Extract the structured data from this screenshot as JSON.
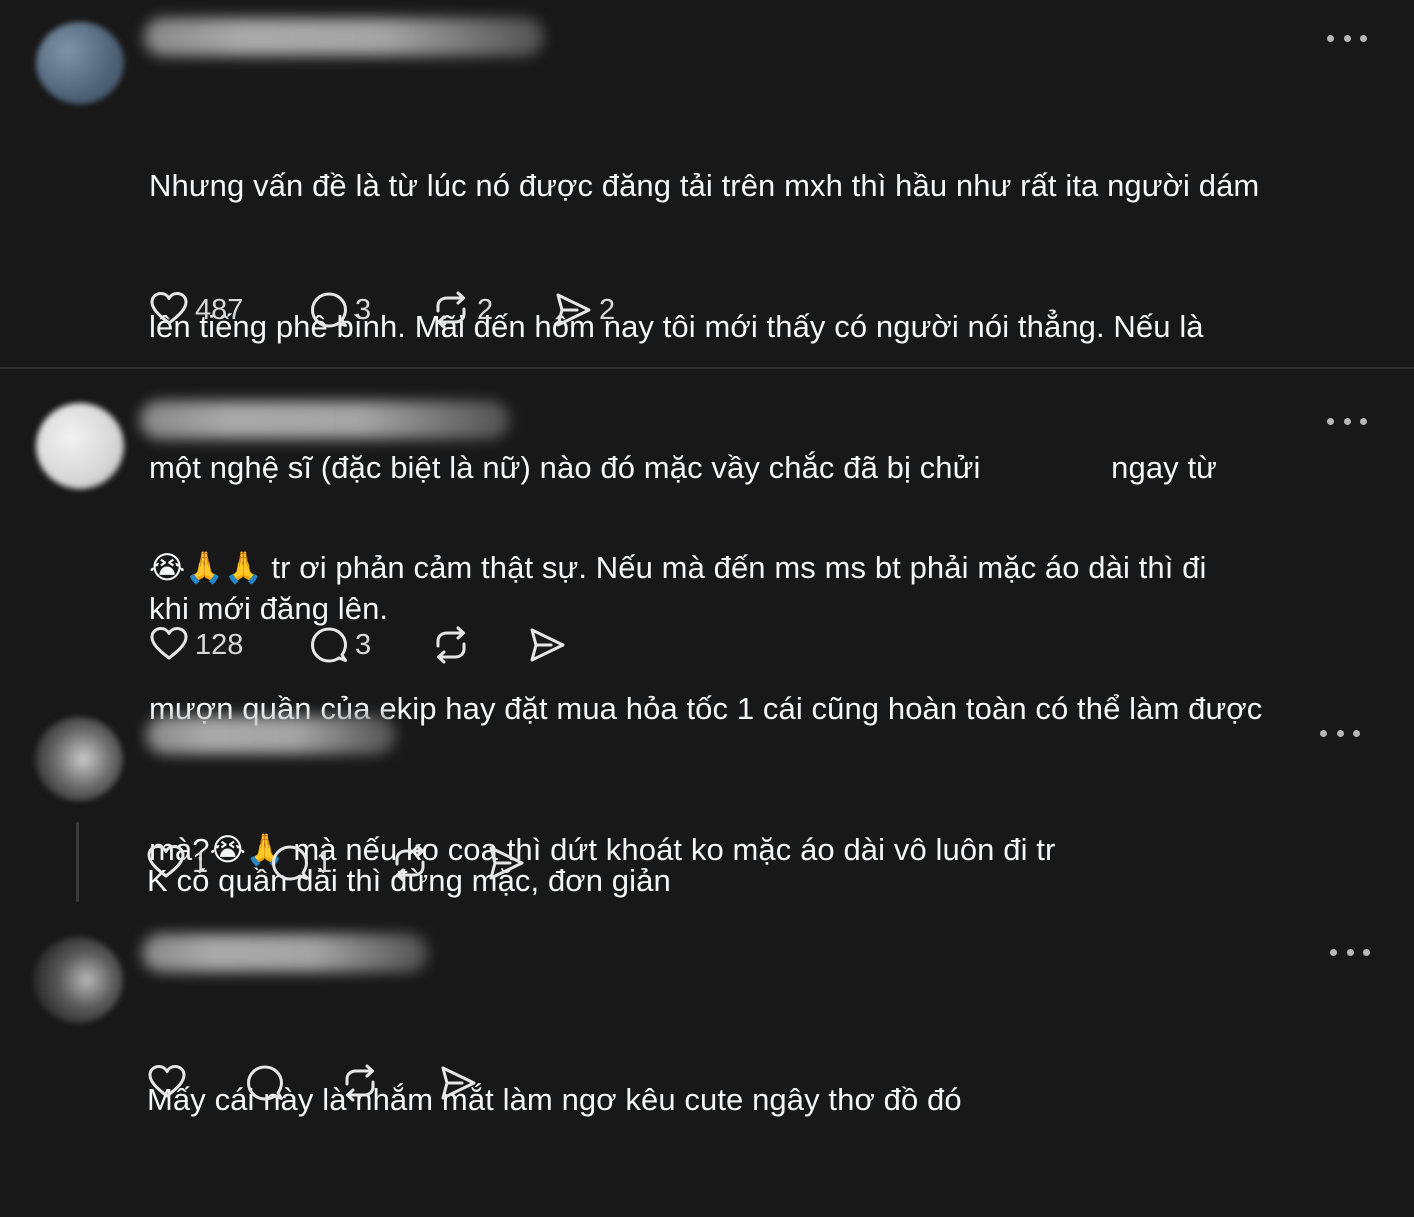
{
  "posts": [
    {
      "text_lines": [
        "Nhưng vấn đề là từ lúc nó được đăng tải trên mxh thì hầu như rất ita người dám",
        "lên tiếng phê bình. Mãi đến hôm nay tôi mới thấy có người nói thẳng. Nếu là",
        "một nghệ sĩ (đặc biệt là nữ) nào đó mặc vầy chắc đã bị chửi               ngay từ",
        "khi mới đăng lên."
      ],
      "likes": "487",
      "replies": "3",
      "reposts": "2",
      "shares": "2"
    },
    {
      "text_lines": [
        "😭🙏🙏 tr ơi phản cảm thật sự. Nếu mà đến ms ms bt phải mặc áo dài thì đi",
        "mượn quần của ekip hay đặt mua hỏa tốc 1 cái cũng hoàn toàn có thể làm được",
        "mà?😭🙏 mà nếu ko coa thì dứt khoát ko mặc áo dài vô luôn đi tr"
      ],
      "likes": "128",
      "replies": "3",
      "reposts": "",
      "shares": ""
    },
    {
      "text_lines": [
        "K có quần dài thì đừng mặc, đơn giản"
      ],
      "likes": "1",
      "replies": "1",
      "reposts": "",
      "shares": ""
    },
    {
      "text_lines": [
        "Mấy cái này là nhắm mắt làm ngơ kêu cute ngây thơ đồ đó"
      ],
      "likes": "",
      "replies": "",
      "reposts": "",
      "shares": ""
    }
  ],
  "icons": {
    "like": "heart-icon",
    "reply": "comment-icon",
    "repost": "repost-icon",
    "share": "share-icon",
    "more": "more-icon"
  },
  "colors": {
    "background": "#181818",
    "text": "#f3f5f7",
    "icon": "#e6e6e6"
  }
}
